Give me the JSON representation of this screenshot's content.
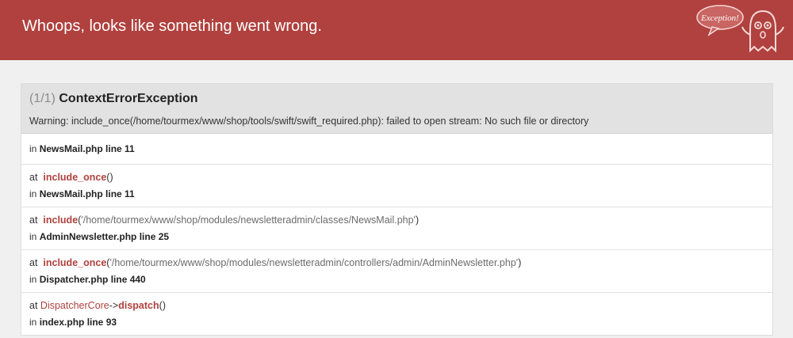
{
  "header": {
    "title": "Whoops, looks like something went wrong.",
    "logo_text": "Exception!"
  },
  "exception": {
    "count": "(1/1)",
    "class_name": "ContextErrorException",
    "message": "Warning: include_once(/home/tourmex/www/shop/tools/swift/swift_required.php): failed to open stream: No such file or directory"
  },
  "frames": [
    {
      "in_label": "in",
      "location": "NewsMail.php line 11"
    },
    {
      "at_label": "at",
      "function": "include_once",
      "args": "",
      "in_label": "in",
      "location": "NewsMail.php line 11"
    },
    {
      "at_label": "at",
      "function": "include",
      "args": "'/home/tourmex/www/shop/modules/newsletteradmin/classes/NewsMail.php'",
      "in_label": "in",
      "location": "AdminNewsletter.php line 25"
    },
    {
      "at_label": "at",
      "function": "include_once",
      "args": "'/home/tourmex/www/shop/modules/newsletteradmin/controllers/admin/AdminNewsletter.php'",
      "in_label": "in",
      "location": "Dispatcher.php line 440"
    },
    {
      "at_label": "at",
      "class_name": "DispatcherCore",
      "arrow": "->",
      "function": "dispatch",
      "args": "",
      "in_label": "in",
      "location": "index.php line 93"
    }
  ],
  "colors": {
    "header_bg": "#b0413e",
    "accent": "#b0413e",
    "page_bg": "#f0f0f0"
  }
}
